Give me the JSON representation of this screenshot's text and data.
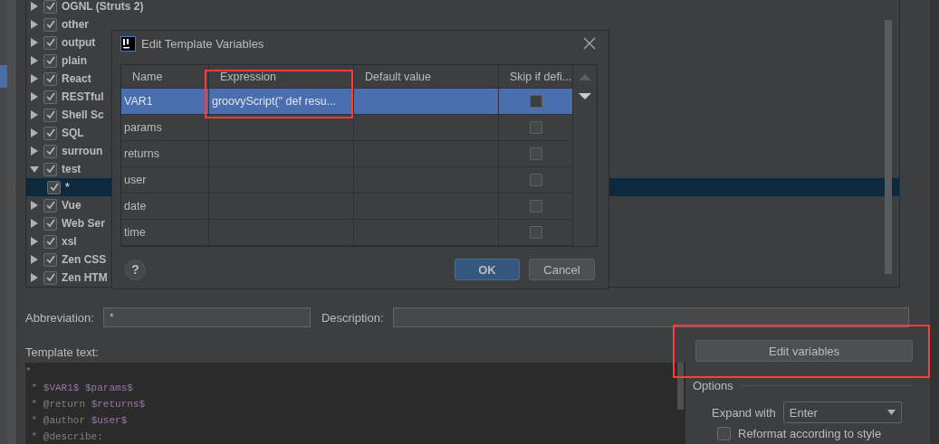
{
  "tree": {
    "items": [
      {
        "label": "OGNL (Struts 2)",
        "checked": true,
        "expanded": false
      },
      {
        "label": "other",
        "checked": true,
        "expanded": false
      },
      {
        "label": "output",
        "checked": true,
        "expanded": false
      },
      {
        "label": "plain",
        "checked": true,
        "expanded": false
      },
      {
        "label": "React",
        "checked": true,
        "expanded": false
      },
      {
        "label": "RESTful",
        "checked": true,
        "expanded": false
      },
      {
        "label": "Shell Sc",
        "checked": true,
        "expanded": false
      },
      {
        "label": "SQL",
        "checked": true,
        "expanded": false
      },
      {
        "label": "surroun",
        "checked": true,
        "expanded": false
      },
      {
        "label": "test",
        "checked": true,
        "expanded": true,
        "children": [
          {
            "label": "*",
            "checked": true,
            "selected": true
          }
        ]
      },
      {
        "label": "Vue",
        "checked": true,
        "expanded": false
      },
      {
        "label": "Web Ser",
        "checked": true,
        "expanded": false
      },
      {
        "label": "xsl",
        "checked": true,
        "expanded": false
      },
      {
        "label": "Zen CSS",
        "checked": true,
        "expanded": false
      },
      {
        "label": "Zen HTM",
        "checked": true,
        "expanded": false
      }
    ]
  },
  "dialog": {
    "title": "Edit Template Variables",
    "columns": [
      {
        "label": "Name"
      },
      {
        "label": "Expression",
        "highlighted": true
      },
      {
        "label": "Default value"
      },
      {
        "label": "Skip if defi..."
      }
    ],
    "rows": [
      {
        "name": "VAR1",
        "expression": "groovyScript(\"    def resu...",
        "skip": false,
        "selected": true
      },
      {
        "name": "params",
        "skip": false,
        "selected": false
      },
      {
        "name": "returns",
        "skip": false,
        "selected": false
      },
      {
        "name": "user",
        "skip": false,
        "selected": false
      },
      {
        "name": "date",
        "skip": false,
        "selected": false
      },
      {
        "name": "time",
        "skip": false,
        "selected": false
      }
    ],
    "help": "?",
    "ok": "OK",
    "cancel": "Cancel"
  },
  "abbreviation": {
    "label": "Abbreviation:",
    "value": "*"
  },
  "description": {
    "label": "Description:"
  },
  "template_text": {
    "label": "Template text:",
    "lines": [
      [
        {
          "kind": "plain",
          "text": "*"
        }
      ],
      [
        {
          "kind": "plain",
          "text": " * "
        },
        {
          "kind": "variable",
          "text": "$VAR1$ $params$"
        }
      ],
      [
        {
          "kind": "plain",
          "text": " * @return "
        },
        {
          "kind": "variable",
          "text": "$returns$"
        }
      ],
      [
        {
          "kind": "plain",
          "text": " * @author "
        },
        {
          "kind": "variable",
          "text": "$user$"
        }
      ],
      [
        {
          "kind": "plain",
          "text": " * @describe:"
        }
      ]
    ]
  },
  "edit_variables": {
    "label": "Edit variables",
    "highlighted": true
  },
  "options": {
    "title": "Options",
    "expand_with": {
      "label": "Expand with",
      "value": "Enter"
    },
    "reformat": {
      "label": "Reformat according to style",
      "checked": false
    }
  }
}
